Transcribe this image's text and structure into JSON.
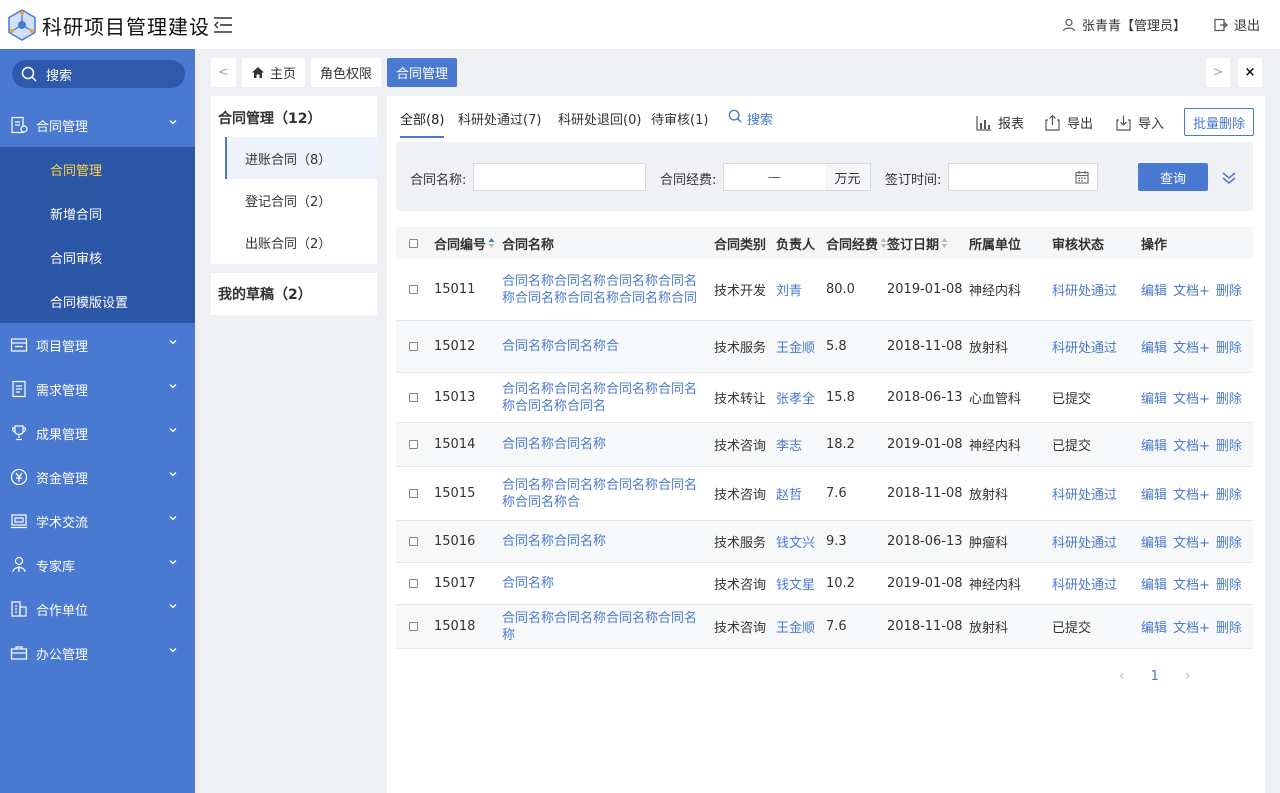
{
  "header": {
    "app_title": "科研项目管理建设",
    "user_name": "张青青【管理员】",
    "logout_label": "退出"
  },
  "sidebar": {
    "search_label": "搜索",
    "groups": [
      {
        "label": "合同管理",
        "icon": "contract-icon"
      },
      {
        "label": "项目管理",
        "icon": "folder-icon"
      },
      {
        "label": "需求管理",
        "icon": "document-icon"
      },
      {
        "label": "成果管理",
        "icon": "trophy-icon"
      },
      {
        "label": "资金管理",
        "icon": "yen-icon"
      },
      {
        "label": "学术交流",
        "icon": "presentation-icon"
      },
      {
        "label": "专家库",
        "icon": "expert-icon"
      },
      {
        "label": "合作单位",
        "icon": "building-icon"
      },
      {
        "label": "办公管理",
        "icon": "briefcase-icon"
      }
    ],
    "sub_items": [
      "合同管理",
      "新增合同",
      "合同审核",
      "合同模版设置"
    ]
  },
  "tabs": {
    "prev": "<",
    "next": ">",
    "close": "×",
    "items": [
      "主页",
      "角色权限",
      "合同管理"
    ]
  },
  "left_panel": {
    "title": "合同管理（12）",
    "items": [
      "进账合同（8）",
      "登记合同（2）",
      "出账合同（2）"
    ],
    "drafts": "我的草稿（2）"
  },
  "main": {
    "filter_tabs": [
      "全部(8)",
      "科研处通过(7)",
      "科研处退回(0)",
      "待审核(1)"
    ],
    "search_label": "搜索",
    "tools": {
      "report": "报表",
      "export": "导出",
      "import": "导入",
      "batch_delete": "批量删除"
    },
    "filter": {
      "name_label": "合同名称:",
      "name_value": "",
      "fund_label": "合同经费:",
      "fund_sep": "—",
      "fund_unit": "万元",
      "date_label": "签订时间:",
      "date_value": "",
      "query_label": "查询"
    },
    "columns": [
      "合同编号",
      "合同名称",
      "合同类别",
      "负责人",
      "合同经费",
      "签订日期",
      "所属单位",
      "审核状态",
      "操作"
    ],
    "rows": [
      {
        "id": "15011",
        "name": "合同名称合同名称合同名称合同名称合同名称合同名称合同名称合同",
        "type": "技术开发",
        "owner": "刘青",
        "fund": "80.0",
        "date": "2019-01-08",
        "dept": "神经内科",
        "status": "科研处通过"
      },
      {
        "id": "15012",
        "name": "合同名称合同名称合",
        "type": "技术服务",
        "owner": "王金顺",
        "fund": "5.8",
        "date": "2018-11-08",
        "dept": "放射科",
        "status": "科研处通过"
      },
      {
        "id": "15013",
        "name": "合同名称合同名称合同名称合同名称合同名称合同名",
        "type": "技术转让",
        "owner": "张孝全",
        "fund": "15.8",
        "date": "2018-06-13",
        "dept": "心血管科",
        "status": "已提交"
      },
      {
        "id": "15014",
        "name": "合同名称合同名称",
        "type": "技术咨询",
        "owner": "李志",
        "fund": "18.2",
        "date": "2019-01-08",
        "dept": "神经内科",
        "status": "已提交"
      },
      {
        "id": "15015",
        "name": "合同名称合同名称合同名称合同名称合同名称合",
        "type": "技术咨询",
        "owner": "赵哲",
        "fund": "7.6",
        "date": "2018-11-08",
        "dept": "放射科",
        "status": "科研处通过"
      },
      {
        "id": "15016",
        "name": "合同名称合同名称",
        "type": "技术服务",
        "owner": "钱文兴",
        "fund": "9.3",
        "date": "2018-06-13",
        "dept": "肿瘤科",
        "status": "科研处通过"
      },
      {
        "id": "15017",
        "name": "合同名称",
        "type": "技术咨询",
        "owner": "钱文星",
        "fund": "10.2",
        "date": "2019-01-08",
        "dept": "神经内科",
        "status": "科研处通过"
      },
      {
        "id": "15018",
        "name": "合同名称合同名称合同名称合同名称",
        "type": "技术咨询",
        "owner": "王金顺",
        "fund": "7.6",
        "date": "2018-11-08",
        "dept": "放射科",
        "status": "已提交"
      }
    ],
    "row_actions": [
      "编辑",
      "文档+",
      "删除"
    ],
    "pager": {
      "prev": "‹",
      "page": "1",
      "next": "›"
    }
  },
  "colors": {
    "accent": "#4a79d1",
    "sidebar": "#4a79d1",
    "sidebar_sub": "#2c56a6",
    "active_sub": "#ffd24a"
  }
}
